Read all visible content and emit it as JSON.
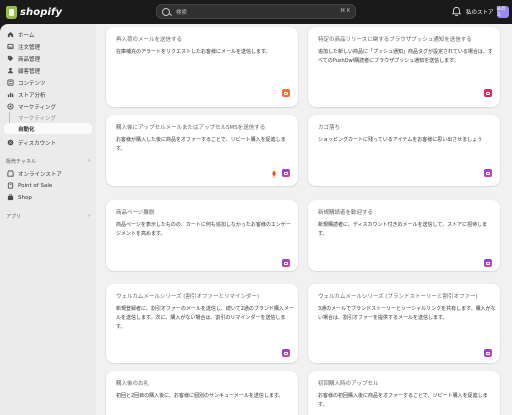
{
  "topbar": {
    "logo_text": "shopify",
    "search_placeholder": "検索",
    "search_shortcut": "⌘ K",
    "store_label": "私のストア",
    "store_avatar": "私のス"
  },
  "sidebar": {
    "items": [
      {
        "label": "ホーム",
        "icon": "home-icon"
      },
      {
        "label": "注文管理",
        "icon": "inbox-icon"
      },
      {
        "label": "商品管理",
        "icon": "tag-icon"
      },
      {
        "label": "顧客管理",
        "icon": "person-icon"
      },
      {
        "label": "コンテンツ",
        "icon": "content-icon"
      },
      {
        "label": "ストア分析",
        "icon": "chart-icon"
      },
      {
        "label": "マーケティング",
        "icon": "target-icon"
      }
    ],
    "sub_items": [
      "マーケティング",
      "自動化"
    ],
    "discount": {
      "label": "ディスカウント",
      "icon": "discount-icon"
    },
    "sales_channels_label": "販売チャネル",
    "channels": [
      {
        "label": "オンラインストア",
        "icon": "store-icon"
      },
      {
        "label": "Point of Sale",
        "icon": "pos-icon"
      },
      {
        "label": "Shop",
        "icon": "shop-icon"
      }
    ],
    "apps_label": "アプリ"
  },
  "cards": [
    {
      "title": "再入荷のメールを送信する",
      "desc": "在庫補充のアラートをリクエストしたお客様にメールを送信します。",
      "icon": "orange"
    },
    {
      "title": "特定の商品リリースに関するブラウザプッシュ通知を送信する",
      "desc": "追加した新しい商品に「プッシュ通知」商品タグが設定されている場合は、すべてのPushOwl購読者にブラウザプッシュ通知を送信します。",
      "icon": "pink"
    },
    {
      "title": "購入後にアップセルメールまたはアップセルSMSを送信する",
      "desc": "お客様が購入した後に商品をオファーすることで、リピート購入を促進します。",
      "icon": "purple"
    },
    {
      "title": "カゴ落ち",
      "desc": "ショッピングカートに残っているアイテムをお客様に思い出させましょう",
      "icon": "purple"
    },
    {
      "title": "商品ページ離脱",
      "desc": "商品ページを表示したものの、カートに何も追加しなかったお客様のエンゲージメントを高めます。",
      "icon": "purple"
    },
    {
      "title": "新規購読者を歓迎する",
      "desc": "新規購読者に、ディスカウント付きのメールを送信して、ストアに招待します。",
      "icon": "purple"
    },
    {
      "title": "ウェルカムメールシリーズ (割引オファーとリマインダー)",
      "desc": "新規登録者に、割引オファーのメールを送信し、続いて2通のブランド購入メールを送信します。次に、購入がない場合は、割引のリマインダーを送信します。",
      "icon": "purple"
    },
    {
      "title": "ウェルカムメールシリーズ (ブランドストーリーと割引オファー)",
      "desc": "3通のメールでブランドストーリーとソーシャルリンクを共有します。購入がない場合は、割引オファーを提供するメールを送信します。",
      "icon": "purple"
    },
    {
      "title": "購入後のお礼",
      "desc": "初回と2回目の購入後に、お客様に個別のサンキューメールを送信します。",
      "icon": "purple"
    },
    {
      "title": "初回購入時のアップセル",
      "desc": "お客様の初回購入後に商品をオファーすることで、リピート購入を促進します。",
      "icon": "purple"
    }
  ],
  "colors": {
    "shopify_green": "#95bf47",
    "sidebar_bg": "#ebebeb",
    "main_bg": "#f1f1f1"
  }
}
